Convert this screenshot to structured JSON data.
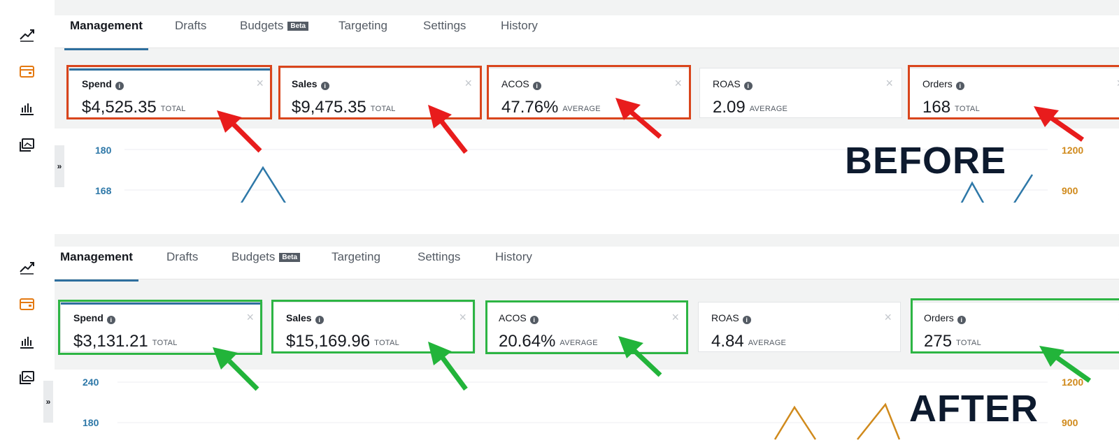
{
  "tabs": [
    {
      "label": "Management",
      "active": true
    },
    {
      "label": "Drafts"
    },
    {
      "label": "Budgets",
      "badge": "Beta"
    },
    {
      "label": "Targeting"
    },
    {
      "label": "Settings"
    },
    {
      "label": "History"
    }
  ],
  "rail_icons": [
    "trend-chart-icon",
    "campaign-wallet-icon",
    "bar-chart-icon",
    "media-gallery-icon"
  ],
  "colors": {
    "before_highlight": "#d9451c",
    "after_highlight": "#2db544",
    "left_axis": "#2e78a8",
    "right_axis": "#d08a1c",
    "tab_underline": "#2e6f9e"
  },
  "before": {
    "banner": "BEFORE",
    "metrics": {
      "spend": {
        "label": "Spend",
        "value": "$4,525.35",
        "unit": "TOTAL"
      },
      "sales": {
        "label": "Sales",
        "value": "$9,475.35",
        "unit": "TOTAL"
      },
      "acos": {
        "label": "ACOS",
        "value": "47.76%",
        "unit": "AVERAGE"
      },
      "roas": {
        "label": "ROAS",
        "value": "2.09",
        "unit": "AVERAGE"
      },
      "orders": {
        "label": "Orders",
        "value": "168",
        "unit": "TOTAL"
      }
    },
    "axis_left": [
      "180",
      "168"
    ],
    "axis_right": [
      "1200",
      "900"
    ]
  },
  "after": {
    "banner": "AFTER",
    "metrics": {
      "spend": {
        "label": "Spend",
        "value": "$3,131.21",
        "unit": "TOTAL"
      },
      "sales": {
        "label": "Sales",
        "value": "$15,169.96",
        "unit": "TOTAL"
      },
      "acos": {
        "label": "ACOS",
        "value": "20.64%",
        "unit": "AVERAGE"
      },
      "roas": {
        "label": "ROAS",
        "value": "4.84",
        "unit": "AVERAGE"
      },
      "orders": {
        "label": "Orders",
        "value": "275",
        "unit": "TOTAL"
      }
    },
    "axis_left": [
      "240",
      "180"
    ],
    "axis_right": [
      "1200",
      "900"
    ]
  }
}
